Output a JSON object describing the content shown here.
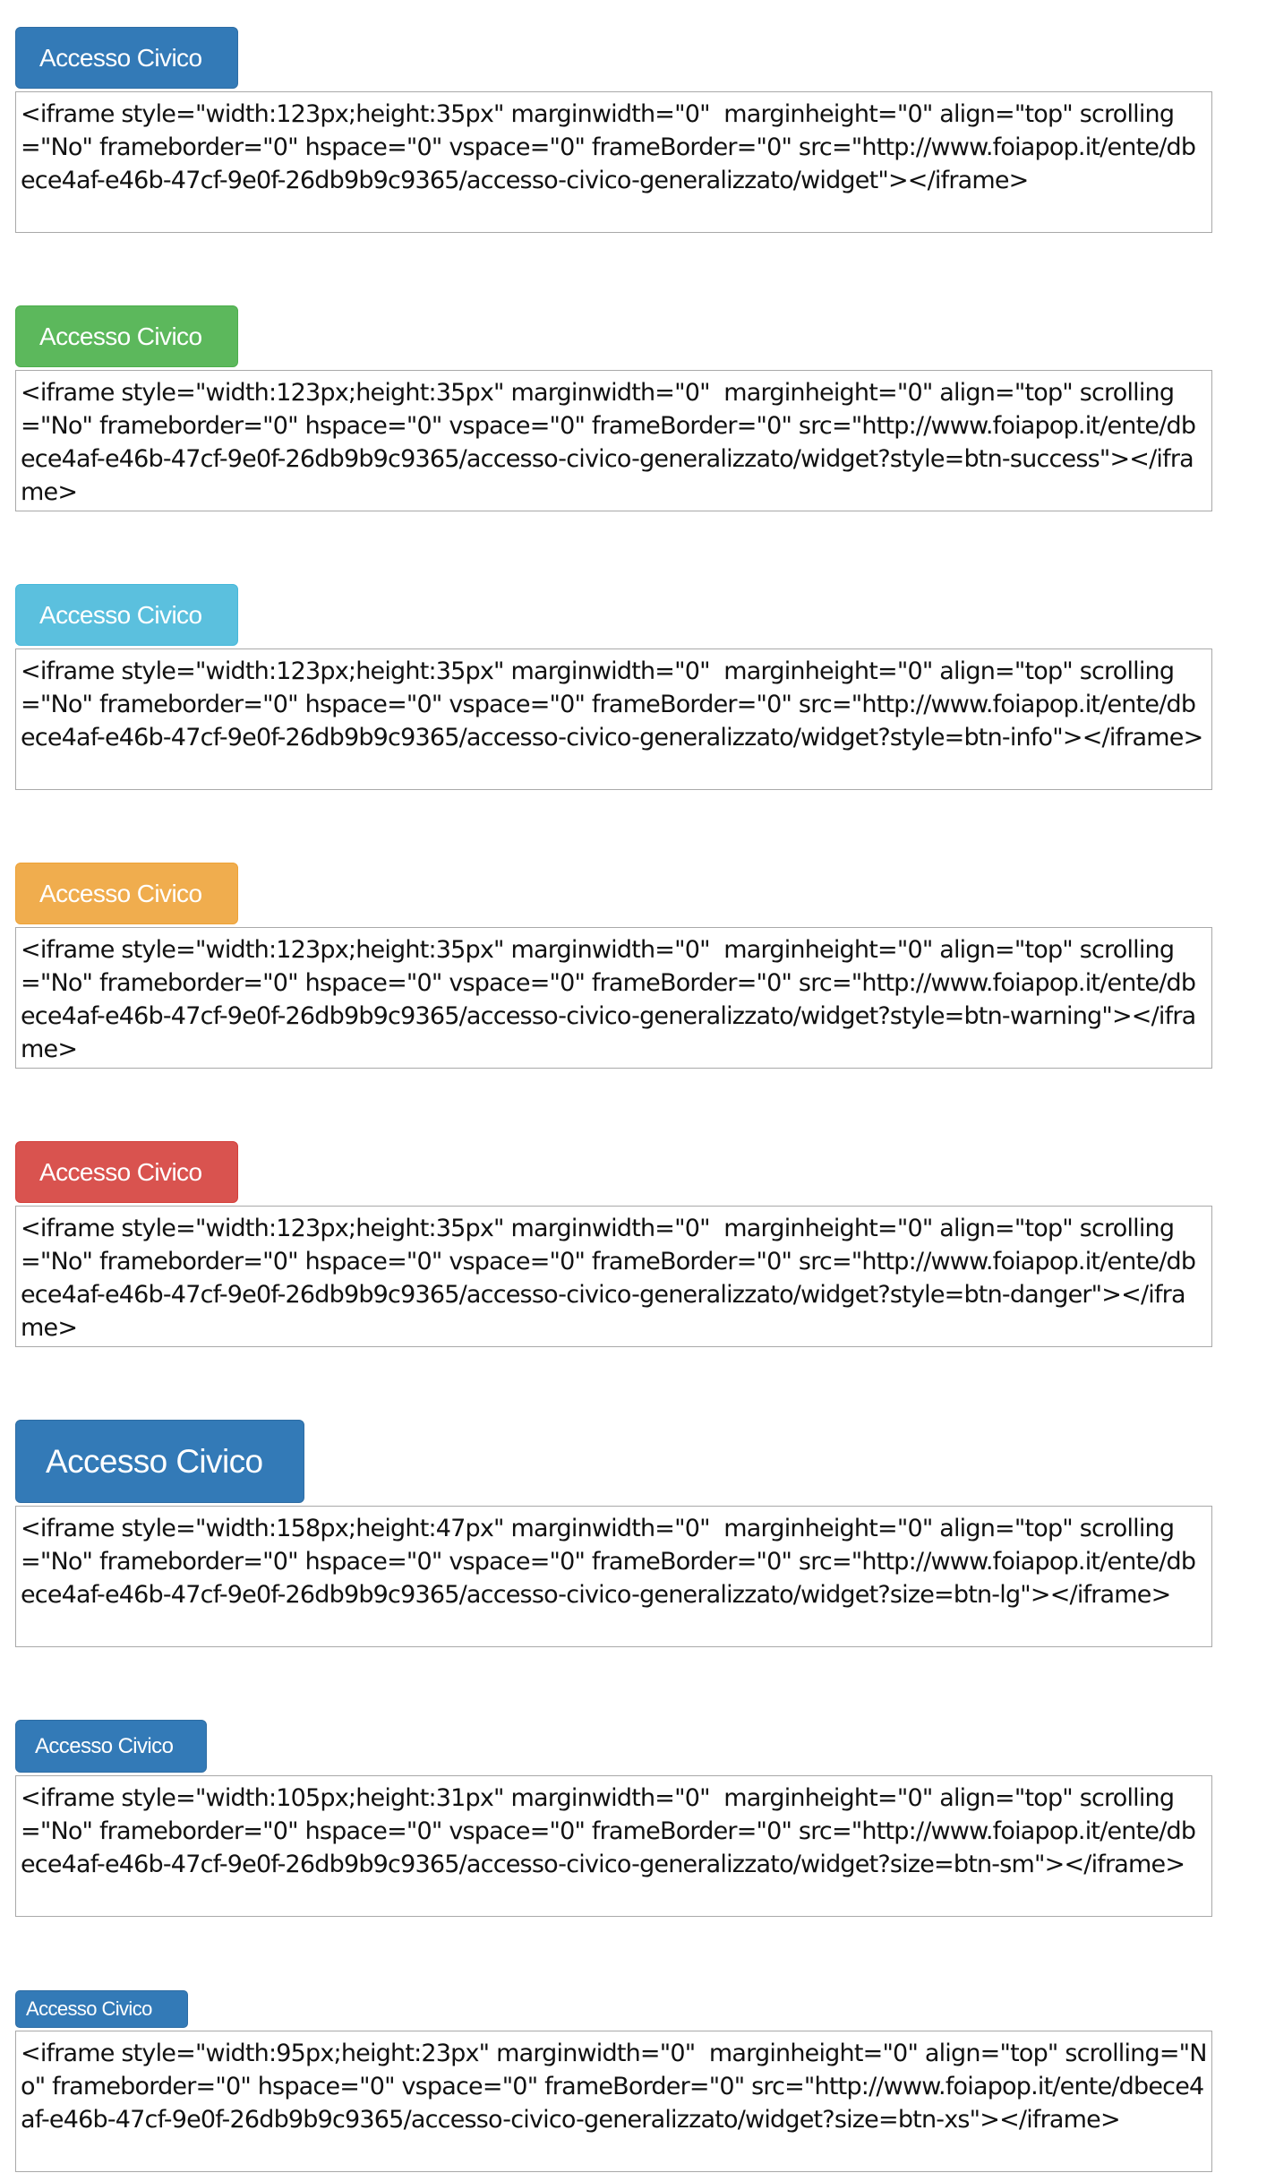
{
  "colors": {
    "primary": "#337ab7",
    "success": "#5cb85c",
    "info": "#5bc0de",
    "warning": "#f0ad4e",
    "danger": "#d9534f"
  },
  "widgets": [
    {
      "button_label": "Accesso Civico",
      "style": "btn-primary",
      "size": "default",
      "code": "<iframe style=\"width:123px;height:35px\" marginwidth=\"0\"  marginheight=\"0\" align=\"top\" scrolling=\"No\" frameborder=\"0\" hspace=\"0\" vspace=\"0\" frameBorder=\"0\" src=\"http://www.foiapop.it/ente/dbece4af-e46b-47cf-9e0f-26db9b9c9365/accesso-civico-generalizzato/widget\"></iframe>"
    },
    {
      "button_label": "Accesso Civico",
      "style": "btn-success",
      "size": "default",
      "code": "<iframe style=\"width:123px;height:35px\" marginwidth=\"0\"  marginheight=\"0\" align=\"top\" scrolling=\"No\" frameborder=\"0\" hspace=\"0\" vspace=\"0\" frameBorder=\"0\" src=\"http://www.foiapop.it/ente/dbece4af-e46b-47cf-9e0f-26db9b9c9365/accesso-civico-generalizzato/widget?style=btn-success\"></iframe>"
    },
    {
      "button_label": "Accesso Civico",
      "style": "btn-info",
      "size": "default",
      "code": "<iframe style=\"width:123px;height:35px\" marginwidth=\"0\"  marginheight=\"0\" align=\"top\" scrolling=\"No\" frameborder=\"0\" hspace=\"0\" vspace=\"0\" frameBorder=\"0\" src=\"http://www.foiapop.it/ente/dbece4af-e46b-47cf-9e0f-26db9b9c9365/accesso-civico-generalizzato/widget?style=btn-info\"></iframe>"
    },
    {
      "button_label": "Accesso Civico",
      "style": "btn-warning",
      "size": "default",
      "code": "<iframe style=\"width:123px;height:35px\" marginwidth=\"0\"  marginheight=\"0\" align=\"top\" scrolling=\"No\" frameborder=\"0\" hspace=\"0\" vspace=\"0\" frameBorder=\"0\" src=\"http://www.foiapop.it/ente/dbece4af-e46b-47cf-9e0f-26db9b9c9365/accesso-civico-generalizzato/widget?style=btn-warning\"></iframe>"
    },
    {
      "button_label": "Accesso Civico",
      "style": "btn-danger",
      "size": "default",
      "code": "<iframe style=\"width:123px;height:35px\" marginwidth=\"0\"  marginheight=\"0\" align=\"top\" scrolling=\"No\" frameborder=\"0\" hspace=\"0\" vspace=\"0\" frameBorder=\"0\" src=\"http://www.foiapop.it/ente/dbece4af-e46b-47cf-9e0f-26db9b9c9365/accesso-civico-generalizzato/widget?style=btn-danger\"></iframe>"
    },
    {
      "button_label": "Accesso Civico",
      "style": "btn-primary",
      "size": "btn-lg",
      "code": "<iframe style=\"width:158px;height:47px\" marginwidth=\"0\"  marginheight=\"0\" align=\"top\" scrolling=\"No\" frameborder=\"0\" hspace=\"0\" vspace=\"0\" frameBorder=\"0\" src=\"http://www.foiapop.it/ente/dbece4af-e46b-47cf-9e0f-26db9b9c9365/accesso-civico-generalizzato/widget?size=btn-lg\"></iframe>"
    },
    {
      "button_label": "Accesso Civico",
      "style": "btn-primary",
      "size": "btn-sm",
      "code": "<iframe style=\"width:105px;height:31px\" marginwidth=\"0\"  marginheight=\"0\" align=\"top\" scrolling=\"No\" frameborder=\"0\" hspace=\"0\" vspace=\"0\" frameBorder=\"0\" src=\"http://www.foiapop.it/ente/dbece4af-e46b-47cf-9e0f-26db9b9c9365/accesso-civico-generalizzato/widget?size=btn-sm\"></iframe>"
    },
    {
      "button_label": "Accesso Civico",
      "style": "btn-primary",
      "size": "btn-xs",
      "code": "<iframe style=\"width:95px;height:23px\" marginwidth=\"0\"  marginheight=\"0\" align=\"top\" scrolling=\"No\" frameborder=\"0\" hspace=\"0\" vspace=\"0\" frameBorder=\"0\" src=\"http://www.foiapop.it/ente/dbece4af-e46b-47cf-9e0f-26db9b9c9365/accesso-civico-generalizzato/widget?size=btn-xs\"></iframe>"
    }
  ]
}
